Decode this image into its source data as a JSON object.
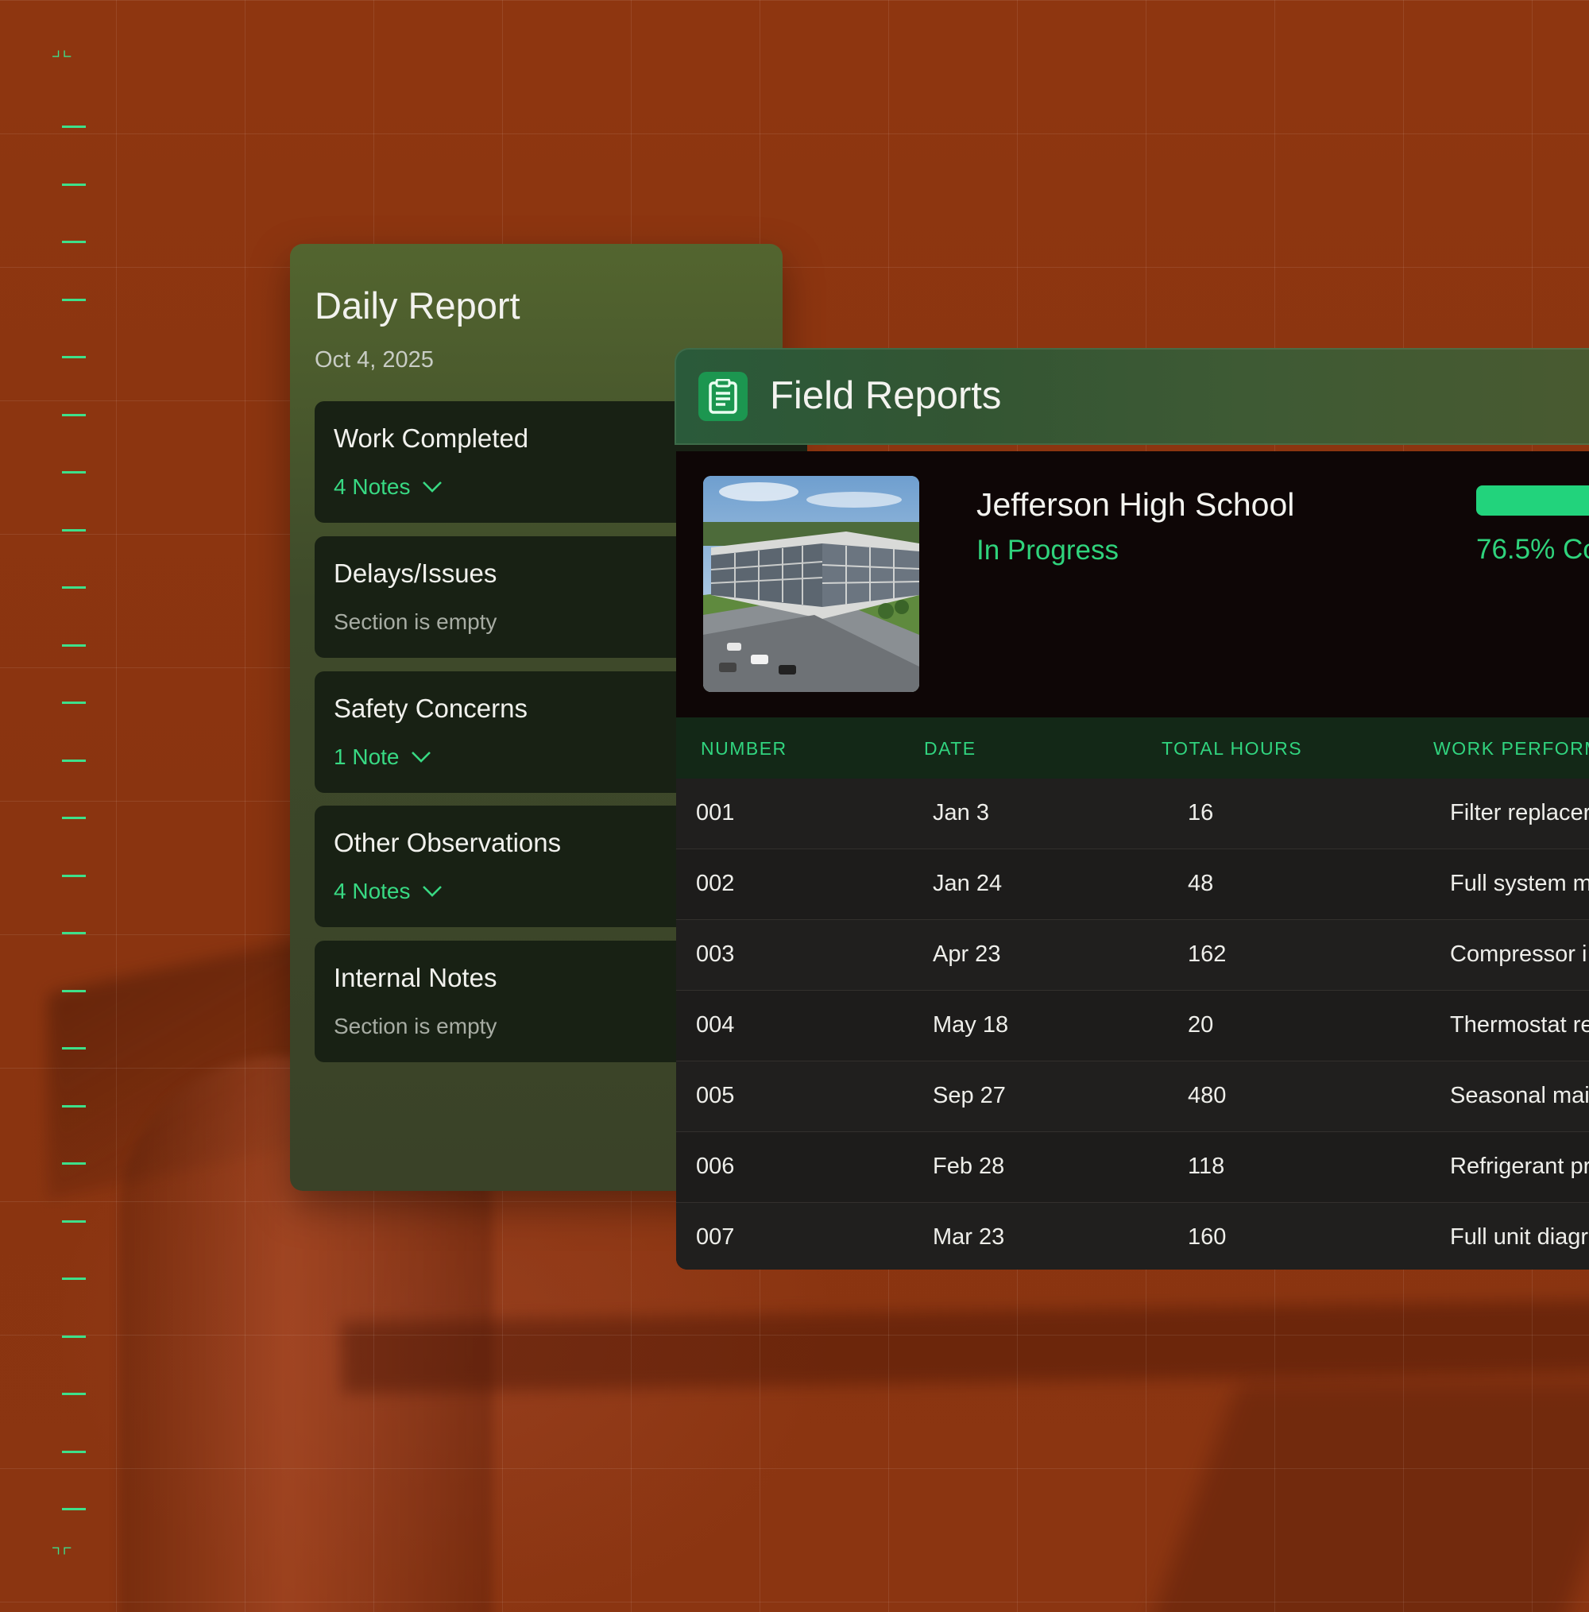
{
  "daily_report": {
    "title": "Daily Report",
    "date": "Oct 4, 2025",
    "sections": [
      {
        "title": "Work Completed",
        "sub": "4 Notes",
        "empty": false
      },
      {
        "title": "Delays/Issues",
        "sub": "Section is empty",
        "empty": true
      },
      {
        "title": "Safety Concerns",
        "sub": "1 Note",
        "empty": false
      },
      {
        "title": "Other Observations",
        "sub": "4 Notes",
        "empty": false
      },
      {
        "title": "Internal Notes",
        "sub": "Section is empty",
        "empty": true
      }
    ]
  },
  "field_reports": {
    "title": "Field Reports",
    "icon": "clipboard-icon",
    "project": {
      "name": "Jefferson High School",
      "status": "In Progress",
      "progress_label": "76.5% Co",
      "progress_fraction": 0.765
    },
    "columns": [
      "NUMBER",
      "DATE",
      "TOTAL HOURS",
      "WORK PERFORM"
    ],
    "rows": [
      {
        "number": "001",
        "date": "Jan 3",
        "hours": "16",
        "work": "Filter replacer"
      },
      {
        "number": "002",
        "date": "Jan 24",
        "hours": "48",
        "work": "Full system m"
      },
      {
        "number": "003",
        "date": "Apr 23",
        "hours": "162",
        "work": "Compressor i"
      },
      {
        "number": "004",
        "date": "May 18",
        "hours": "20",
        "work": "Thermostat re"
      },
      {
        "number": "005",
        "date": "Sep 27",
        "hours": "480",
        "work": "Seasonal mai"
      },
      {
        "number": "006",
        "date": "Feb 28",
        "hours": "118",
        "work": "Refrigerant pr"
      },
      {
        "number": "007",
        "date": "Mar 23",
        "hours": "160",
        "work": "Full unit diagr"
      }
    ]
  },
  "colors": {
    "background": "#8f3510",
    "accent": "#22d37c",
    "panel_dark": "#0d0606"
  }
}
